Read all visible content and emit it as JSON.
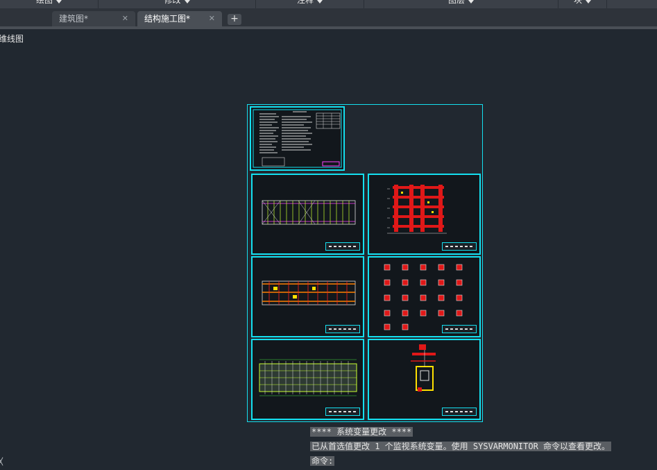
{
  "ribbon": {
    "panels": [
      "绘图",
      "修改",
      "注释",
      "图层",
      "块"
    ]
  },
  "file_tabs": [
    {
      "label": "建筑图*",
      "active": false
    },
    {
      "label": "结构施工图*",
      "active": true
    }
  ],
  "add_tab_label": "+",
  "viewport": {
    "label": "维线图"
  },
  "command_history": [
    "**** 系统变量更改 ****",
    "已从首选值更改 1 个监视系统变量。使用 SYSVARMONITOR 命令以查看更改。",
    "命令:"
  ],
  "colors": {
    "background": "#212830",
    "sheet_border": "#14e0f0",
    "ribbon": "#3b4048",
    "tab_active": "#4a4f56"
  }
}
